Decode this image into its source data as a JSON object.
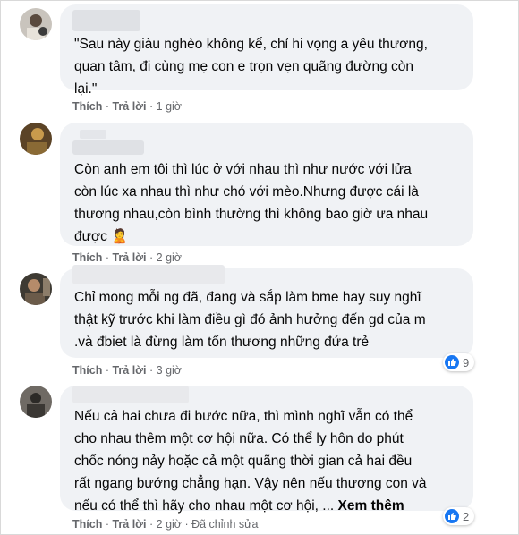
{
  "colors": {
    "bubble": "#f0f2f5",
    "meta": "#65676b",
    "like": "#1877f2"
  },
  "comments": [
    {
      "text": "\"Sau này giàu nghèo không kể, chỉ hi vọng a yêu thương,\nquan tâm, đi cùng mẹ con e trọn vẹn quãng đường còn\nlại.\"",
      "like_label": "Thích",
      "reply_label": "Trả lời",
      "time": "1 giờ"
    },
    {
      "text": "Còn anh em tôi thì lúc ở với nhau thì như nước với lửa\ncòn lúc xa nhau thì như chó với mèo.Nhưng được cái là\nthương nhau,còn bình thường thì không bao giờ ưa nhau\nđược 🙎",
      "like_label": "Thích",
      "reply_label": "Trả lời",
      "time": "2 giờ"
    },
    {
      "text": "Chỉ mong mỗi ng đã, đang và sắp làm bme hay suy nghĩ\nthật kỹ trước khi làm điều gì đó ảnh hưởng đến gd của m\n.và đbiet là đừng làm tổn thương những đứa trẻ",
      "like_label": "Thích",
      "reply_label": "Trả lời",
      "time": "3 giờ",
      "reaction_count": "9"
    },
    {
      "text": "Nếu cả hai chưa đi bước nữa, thì mình nghĩ vẫn có thể\ncho nhau thêm một cơ hội nữa. Có thể ly hôn do phút\nchốc nóng nảy hoặc cả một quãng thời gian cả hai đều\nrất ngang bướng chẳng hạn. Vậy nên nếu thương con và\nnếu có thể thì hãy cho nhau một cơ hội, ... ",
      "see_more": "Xem thêm",
      "like_label": "Thích",
      "reply_label": "Trả lời",
      "time": "2 giờ",
      "edited": "Đã chỉnh sửa",
      "reaction_count": "2"
    }
  ]
}
